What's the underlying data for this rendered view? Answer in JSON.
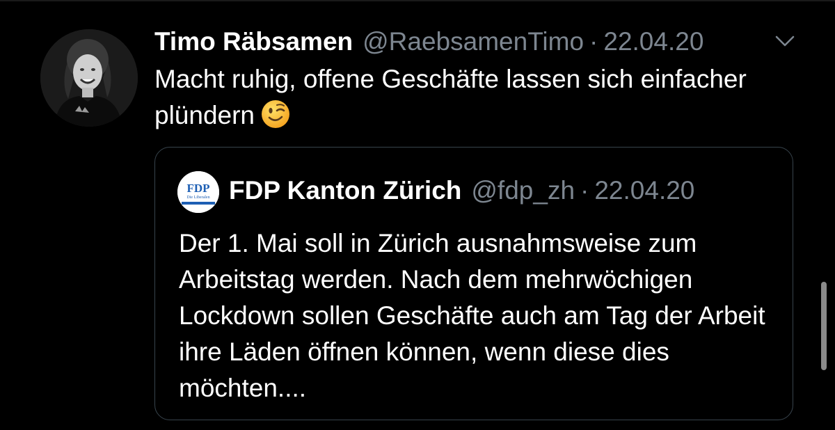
{
  "tweet": {
    "author_name": "Timo Räbsamen",
    "author_handle": "@RaebsamenTimo",
    "separator": "·",
    "date": "22.04.20",
    "text": "Macht ruhig, offene Geschäfte lassen sich einfacher plündern",
    "emoji": "winking-face"
  },
  "quoted_tweet": {
    "author_name": "FDP Kanton Zürich",
    "author_handle": "@fdp_zh",
    "separator": "·",
    "date": "22.04.20",
    "avatar_logo_text": "FDP",
    "avatar_logo_subtext": "Die Liberalen",
    "text": "Der 1. Mai soll in Zürich ausnahmsweise zum Arbeitstag werden. Nach dem mehrwöchigen Lockdown sollen Geschäfte auch am Tag der Arbeit ihre Läden öffnen können, wenn diese dies möchten...."
  },
  "icons": {
    "more": "chevron-down-icon"
  },
  "colors": {
    "background": "#000000",
    "primary_text": "#ffffff",
    "secondary_text": "#7d8690",
    "card_border": "#38444d",
    "fdp_blue": "#1d5fb4"
  }
}
